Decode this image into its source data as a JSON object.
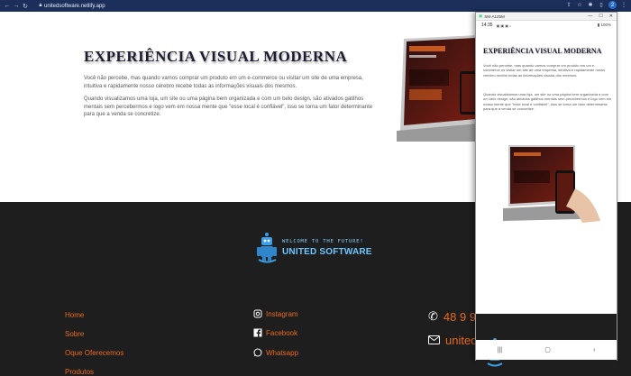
{
  "browser": {
    "url": "unitedsoftware.netlify.app",
    "avatar_letter": "2"
  },
  "hero": {
    "title": "EXPERIÊNCIA VISUAL MODERNA",
    "paragraph1": "Você não percebe, mas quando vamos comprar um produto em um e-commerce ou visitar um site de uma empresa, intuitiva e rapidamente nosso cérebro recebe todas as informações visuais dos mesmos.",
    "paragraph2": "Quando visualizamos uma loja, um site ou uma página bem organizada e com um belo design, são ativados gatilhos mentais sem percebermos e logo vem em nossa mente que \"esse local é confiável\", isso se torna um fator determinante para que a venda se concretize."
  },
  "footer": {
    "logo_tagline": "WELCOME TO THE FUTURE!",
    "logo_name": "UNITED SOFTWARE",
    "links": [
      "Home",
      "Sobre",
      "Oque Oferecemos",
      "Produtos"
    ],
    "social": [
      "Instagram",
      "Facebook",
      "Whatsapp"
    ],
    "phone": "48 9 9",
    "email": "united"
  },
  "phone_window": {
    "title": "SM-A125M",
    "status_time": "14:35",
    "status_right": "▮ 100%"
  },
  "colors": {
    "accent": "#e8691f",
    "chrome": "#1b2f5a",
    "footer_bg": "#1e1e1e"
  }
}
